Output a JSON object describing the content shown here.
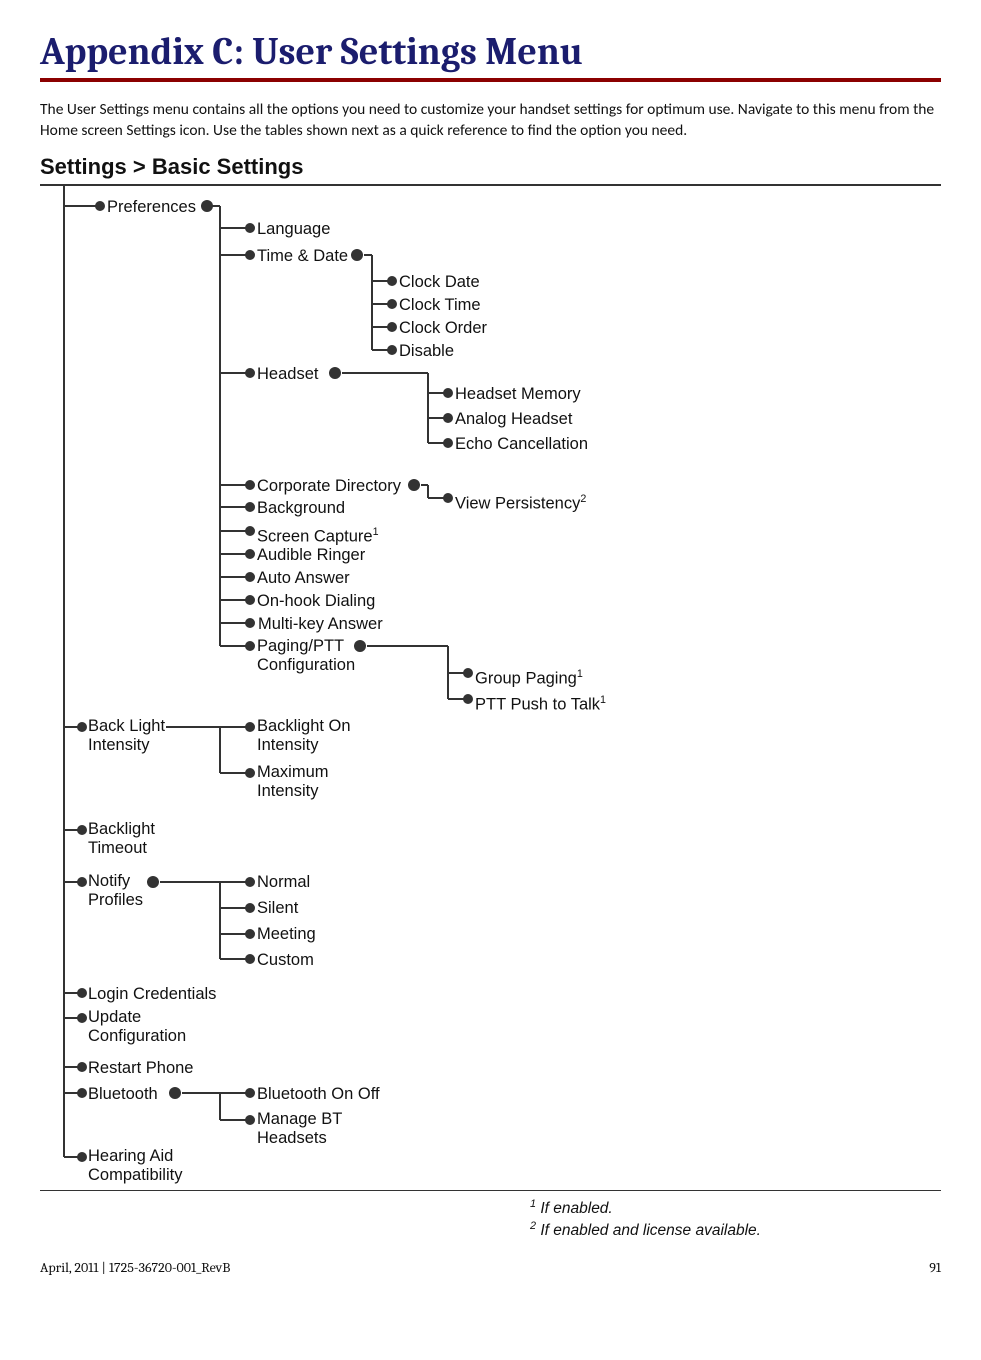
{
  "title": "Appendix C: User Settings Menu",
  "intro": "The User Settings menu contains all the options you need to customize your handset settings for optimum use. Navigate to this menu from the Home screen Settings icon. Use the tables shown next as a quick reference to find the option you need.",
  "breadcrumb": "Settings > Basic Settings",
  "nodes": {
    "preferences": "Preferences",
    "back_light_intensity": "Back Light<br>Intensity",
    "backlight_timeout": "Backlight<br>Timeout",
    "notify_profiles": "Notify<br>Profiles",
    "login_credentials": "Login Credentials",
    "update_configuration": "Update<br>Configuration",
    "restart_phone": "Restart Phone",
    "bluetooth": "Bluetooth",
    "hearing_aid": "Hearing Aid<br>Compatibility",
    "language": "Language",
    "time_date": "Time & Date",
    "headset": "Headset",
    "corporate_directory": "Corporate Directory",
    "background": "Background",
    "screen_capture": "Screen Capture",
    "audible_ringer": "Audible Ringer",
    "auto_answer": "Auto Answer",
    "onhook_dialing": "On-hook Dialing",
    "multikey_answer": "Multi-key Answer",
    "paging_ptt": "Paging/PTT<br>Configuration",
    "backlight_on_intensity": "Backlight On<br>Intensity",
    "maximum_intensity": "Maximum<br>Intensity",
    "normal": "Normal",
    "silent": "Silent",
    "meeting": "Meeting",
    "custom": "Custom",
    "bt_onoff": "Bluetooth On Off",
    "manage_bt": "Manage BT<br>Headsets",
    "clock_date": "Clock Date",
    "clock_time": "Clock Time",
    "clock_order": "Clock Order",
    "disable": "Disable",
    "headset_memory": "Headset Memory",
    "analog_headset": "Analog Headset",
    "echo_cancellation": "Echo Cancellation",
    "view_persistency": "View Persistency",
    "group_paging": "Group Paging",
    "ptt_push_to_talk": "PTT Push to Talk"
  },
  "footnotes": {
    "f1": "If enabled.",
    "f2": "If enabled and license available."
  },
  "footer": {
    "left": "April, 2011  |  1725-36720-001_RevB",
    "page": "91"
  }
}
